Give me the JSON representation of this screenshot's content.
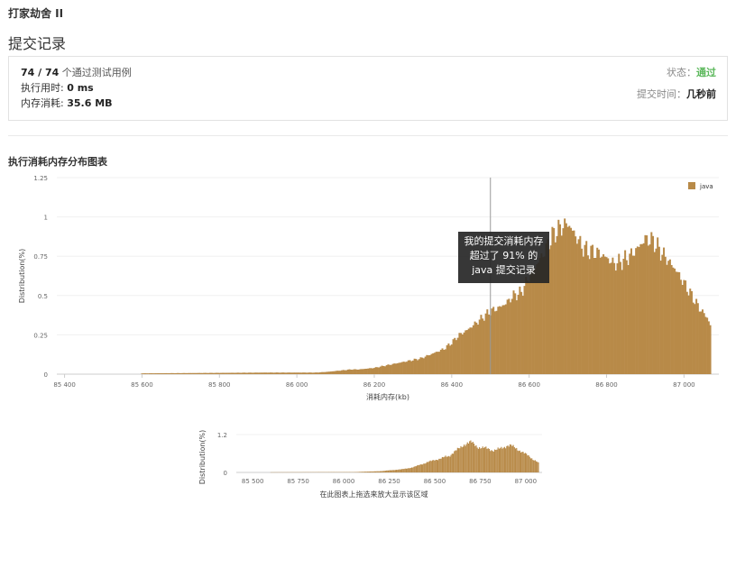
{
  "problem": {
    "title": "打家劫舍 II"
  },
  "page": {
    "section_title": "提交记录"
  },
  "summary": {
    "passed": "74 / 74",
    "passed_suffix": "个通过测试用例",
    "runtime_label": "执行用时:",
    "runtime_value": "0 ms",
    "memory_label": "内存消耗:",
    "memory_value": "35.6 MB",
    "status_label": "状态：",
    "status_value": "通过",
    "status_color": "#5cb85c",
    "submit_time_label": "提交时间：",
    "submit_time_value": "几秒前"
  },
  "chart": {
    "title": "执行消耗内存分布图表",
    "tooltip_line1": "我的提交消耗内存",
    "tooltip_line2": "超过了 91% 的",
    "tooltip_line3": "java 提交记录",
    "navigator_hint": "在此图表上拖选来放大显示该区域"
  },
  "chart_data": [
    {
      "type": "bar",
      "xlabel": "消耗内存(kb)",
      "ylabel": "Distribution(%)",
      "xlim": [
        85380,
        87090
      ],
      "ylim": [
        0,
        1.25
      ],
      "x_ticks": [
        "85 400",
        "85 600",
        "85 800",
        "86 000",
        "86 200",
        "86 400",
        "86 600",
        "86 800",
        "87 000"
      ],
      "y_ticks": [
        "0",
        "0.25",
        "0.5",
        "0.75",
        "1",
        "1.25"
      ],
      "legend": [
        "java"
      ],
      "legend_position": "top-right",
      "marker_x": 86500,
      "color": "#b88a48",
      "series": [
        {
          "name": "java",
          "x": [
            85600,
            85920,
            86050,
            86080,
            86100,
            86120,
            86140,
            86160,
            86180,
            86200,
            86220,
            86240,
            86260,
            86280,
            86300,
            86320,
            86340,
            86360,
            86380,
            86400,
            86420,
            86440,
            86460,
            86480,
            86500,
            86520,
            86540,
            86560,
            86580,
            86600,
            86620,
            86640,
            86660,
            86680,
            86700,
            86720,
            86740,
            86760,
            86780,
            86800,
            86820,
            86840,
            86860,
            86880,
            86900,
            86920,
            86940,
            86960,
            86980,
            87000,
            87020,
            87040,
            87060,
            87070
          ],
          "values": [
            0.005,
            0.01,
            0.01,
            0.015,
            0.02,
            0.025,
            0.03,
            0.03,
            0.035,
            0.04,
            0.05,
            0.06,
            0.07,
            0.08,
            0.09,
            0.1,
            0.12,
            0.14,
            0.16,
            0.2,
            0.25,
            0.28,
            0.32,
            0.36,
            0.4,
            0.42,
            0.45,
            0.5,
            0.52,
            0.62,
            0.7,
            0.78,
            0.88,
            0.93,
            0.96,
            0.88,
            0.8,
            0.78,
            0.77,
            0.74,
            0.7,
            0.72,
            0.75,
            0.8,
            0.86,
            0.85,
            0.78,
            0.72,
            0.66,
            0.58,
            0.5,
            0.42,
            0.36,
            0.3
          ]
        }
      ]
    },
    {
      "type": "bar",
      "ylabel": "Distribution(%)",
      "xlim": [
        85410,
        87090
      ],
      "ylim": [
        0,
        1.2
      ],
      "x_ticks": [
        "85 500",
        "85 750",
        "86 000",
        "86 250",
        "86 500",
        "86 750",
        "87 000"
      ],
      "y_ticks": [
        "0",
        "1.2"
      ],
      "color": "#b88a48"
    }
  ]
}
